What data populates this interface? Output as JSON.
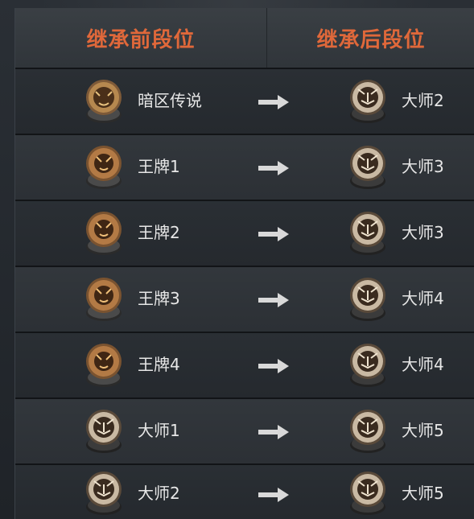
{
  "header": {
    "before_label": "继承前段位",
    "after_label": "继承后段位"
  },
  "rows": [
    {
      "before": {
        "rank": "暗区传说",
        "icon": "legend-beast-icon"
      },
      "after": {
        "rank": "大师2",
        "icon": "master-tiger-icon"
      }
    },
    {
      "before": {
        "rank": "王牌1",
        "icon": "ace-lion-icon"
      },
      "after": {
        "rank": "大师3",
        "icon": "master-tiger-icon"
      }
    },
    {
      "before": {
        "rank": "王牌2",
        "icon": "ace-lion-icon"
      },
      "after": {
        "rank": "大师3",
        "icon": "master-tiger-icon"
      }
    },
    {
      "before": {
        "rank": "王牌3",
        "icon": "ace-lion-icon"
      },
      "after": {
        "rank": "大师4",
        "icon": "master-tiger-icon"
      }
    },
    {
      "before": {
        "rank": "王牌4",
        "icon": "ace-lion-icon"
      },
      "after": {
        "rank": "大师4",
        "icon": "master-tiger-icon"
      }
    },
    {
      "before": {
        "rank": "大师1",
        "icon": "master-tiger-icon"
      },
      "after": {
        "rank": "大师5",
        "icon": "master-tiger-icon"
      }
    },
    {
      "before": {
        "rank": "大师2",
        "icon": "master-tiger-icon"
      },
      "after": {
        "rank": "大师5",
        "icon": "master-tiger-icon"
      }
    }
  ],
  "colors": {
    "header_text": "#e0683a",
    "row_text": "#e7e7e7",
    "arrow": "#d9d9d9"
  }
}
